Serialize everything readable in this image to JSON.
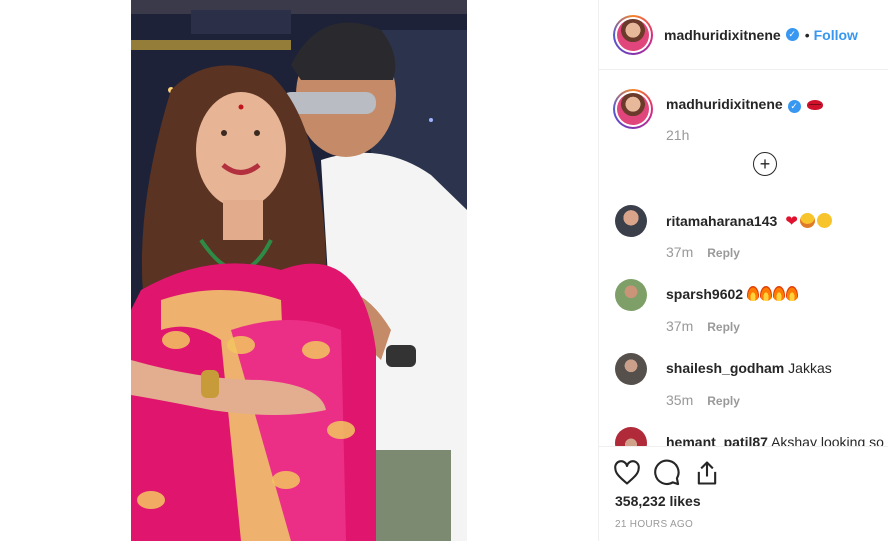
{
  "post": {
    "photo_icon": "photo-woman-pink-saree-man-sunglasses"
  },
  "header": {
    "username": "madhuridixitnene",
    "verified_icon": "verified-badge-icon",
    "separator": "•",
    "follow_label": "Follow"
  },
  "caption": {
    "username": "madhuridixitnene",
    "emoji": "lips-emoji",
    "time": "21h"
  },
  "comments": [
    {
      "username": "ritamaharana143",
      "text": "",
      "emojis": [
        "heart",
        "star-eyes",
        "kiss"
      ],
      "time": "37m",
      "reply_label": "Reply"
    },
    {
      "username": "sparsh9602",
      "text": "",
      "emojis": [
        "fire",
        "fire",
        "fire",
        "fire"
      ],
      "time": "37m",
      "reply_label": "Reply"
    },
    {
      "username": "shailesh_godham",
      "text": "Jakkas",
      "time": "35m",
      "reply_label": "Reply"
    },
    {
      "username": "hemant_patil87",
      "text": "Akshay looking so"
    }
  ],
  "actions": {
    "like_icon": "heart-outline-icon",
    "comment_icon": "comment-bubble-icon",
    "share_icon": "share-upload-icon",
    "likes": "358,232 likes",
    "posted": "21 HOURS AGO"
  },
  "colors": {
    "link": "#3897f0",
    "muted": "#999999",
    "text": "#262626"
  }
}
